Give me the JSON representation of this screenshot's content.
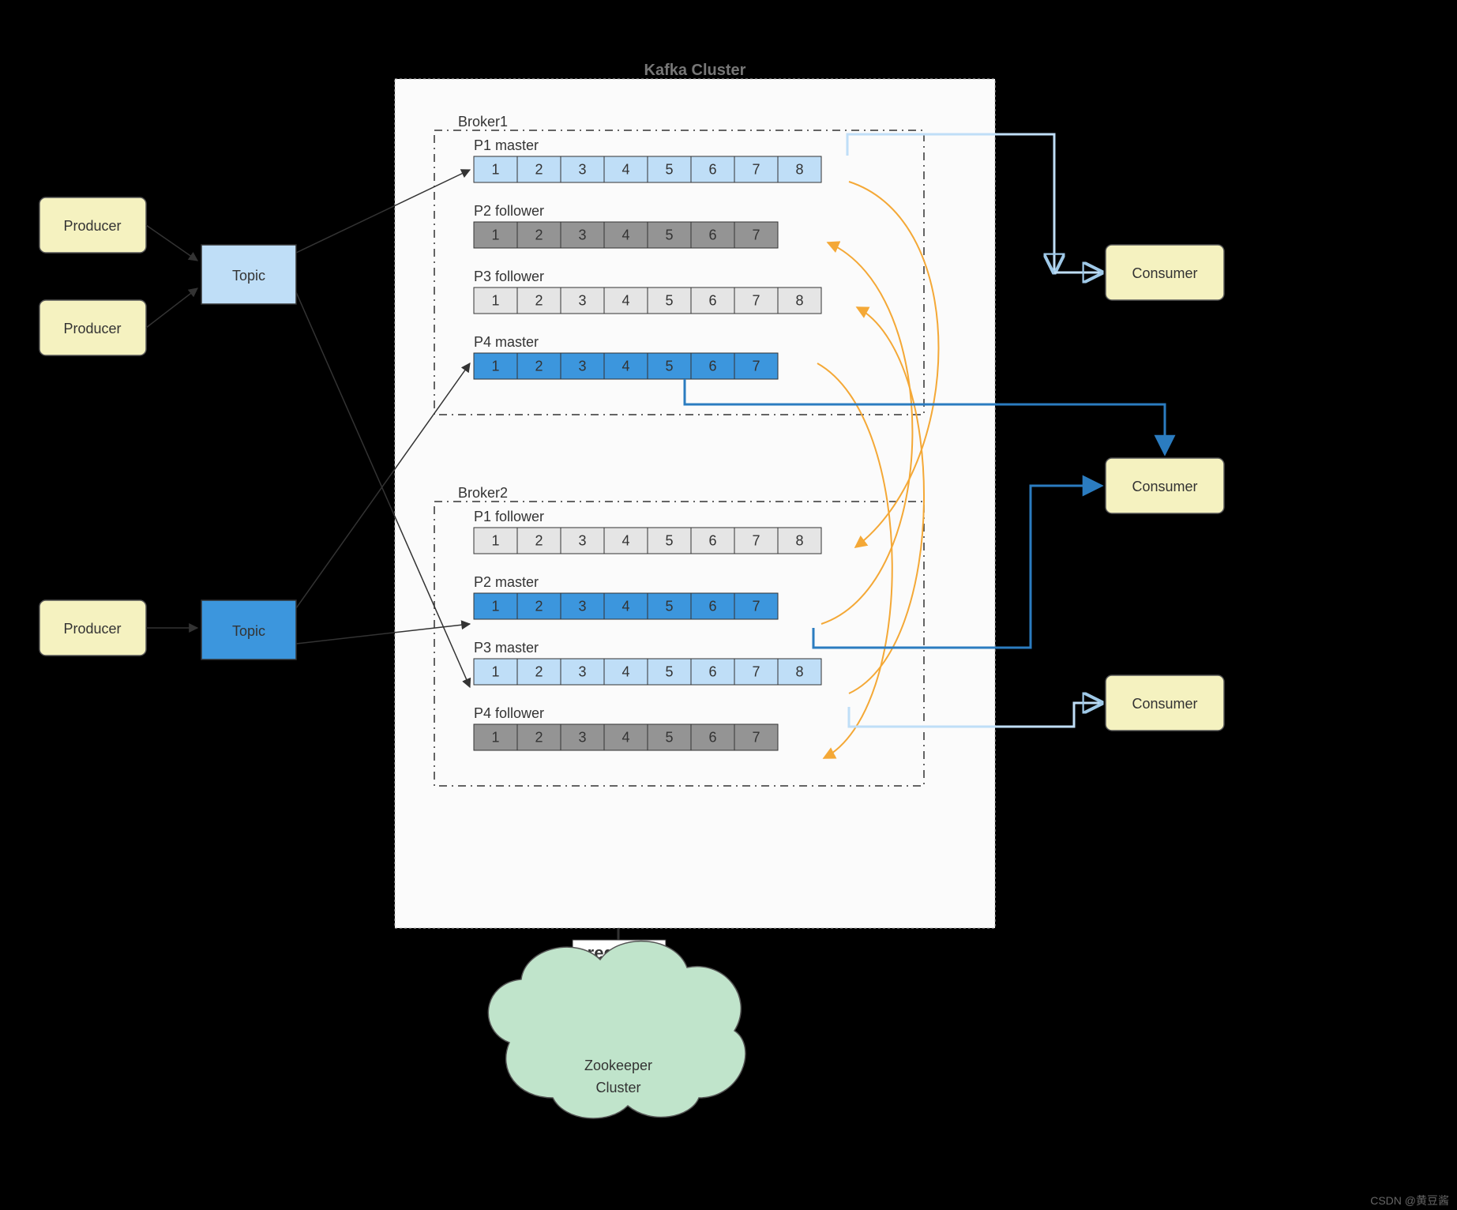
{
  "producers": [
    "Producer",
    "Producer",
    "Producer"
  ],
  "topics": [
    "Topic",
    "Topic"
  ],
  "cluster_title": "Kafka Cluster",
  "brokers": [
    {
      "name": "Broker1",
      "partitions": [
        {
          "label": "P1 master",
          "style": "lblue",
          "cells": [
            1,
            2,
            3,
            4,
            5,
            6,
            7,
            8
          ]
        },
        {
          "label": "P2 follower",
          "style": "gray",
          "cells": [
            1,
            2,
            3,
            4,
            5,
            6,
            7
          ]
        },
        {
          "label": "P3 follower",
          "style": "lgray",
          "cells": [
            1,
            2,
            3,
            4,
            5,
            6,
            7,
            8
          ]
        },
        {
          "label": "P4 master",
          "style": "blue",
          "cells": [
            1,
            2,
            3,
            4,
            5,
            6,
            7
          ]
        }
      ]
    },
    {
      "name": "Broker2",
      "partitions": [
        {
          "label": "P1 follower",
          "style": "lgray",
          "cells": [
            1,
            2,
            3,
            4,
            5,
            6,
            7,
            8
          ]
        },
        {
          "label": "P2 master",
          "style": "blue",
          "cells": [
            1,
            2,
            3,
            4,
            5,
            6,
            7
          ]
        },
        {
          "label": "P3 master",
          "style": "lblue",
          "cells": [
            1,
            2,
            3,
            4,
            5,
            6,
            7,
            8
          ]
        },
        {
          "label": "P4 follower",
          "style": "gray",
          "cells": [
            1,
            2,
            3,
            4,
            5,
            6,
            7
          ]
        }
      ]
    }
  ],
  "consumers": [
    "Consumer",
    "Consumer",
    "Consumer"
  ],
  "register": "register",
  "zookeeper": "Zookeeper\nCluster",
  "watermark": "CSDN @黄豆酱"
}
